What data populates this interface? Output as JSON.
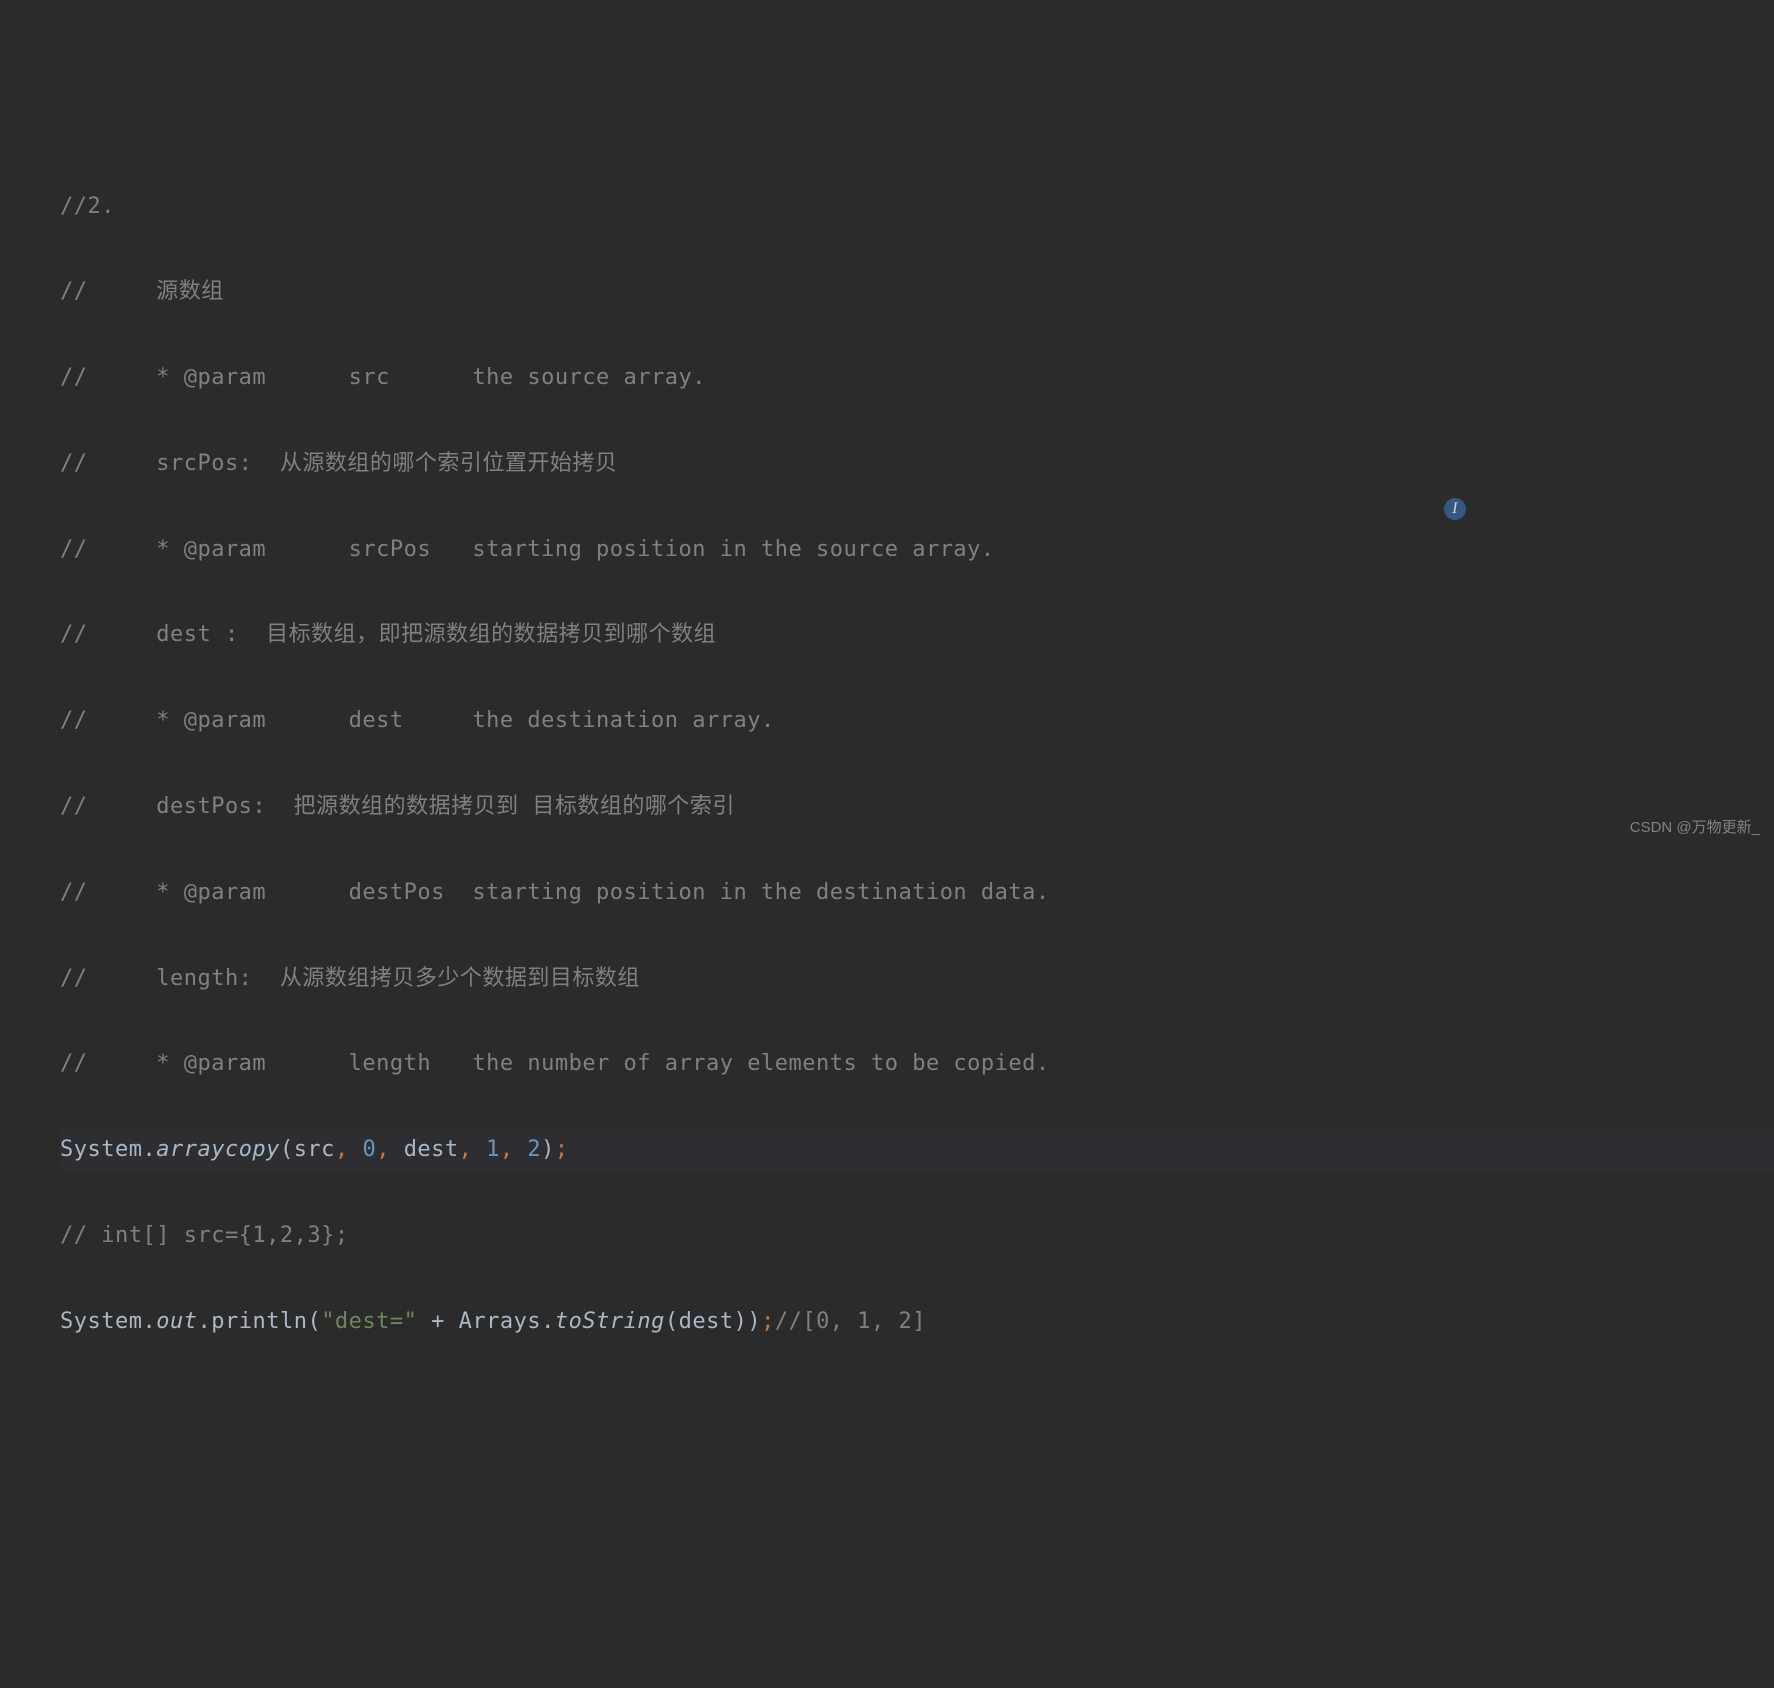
{
  "lines": {
    "l1": "//2.",
    "l2": "//     源数组",
    "l3": "//     * @param      src      the source array.",
    "l4": "//     srcPos:  从源数组的哪个索引位置开始拷贝",
    "l5": "//     * @param      srcPos   starting position in the source array.",
    "l6": "//     dest :  目标数组，即把源数组的数据拷贝到哪个数组",
    "l7": "//     * @param      dest     the destination array.",
    "l8": "//     destPos:  把源数组的数据拷贝到 目标数组的哪个索引",
    "l9": "//     * @param      destPos  starting position in the destination data.",
    "l10": "//     length:  从源数组拷贝多少个数据到目标数组",
    "l11": "//     * @param      length   the number of array elements to be copied.",
    "l13": "// int[] src={1,2,3};"
  },
  "code": {
    "system1": "System.",
    "arraycopy": "arraycopy",
    "open1": "(",
    "src": "src",
    "comma": ", ",
    "n0": "0",
    "dest": "dest",
    "n1": "1",
    "n2": "2",
    "close1": ")",
    "semi": ";",
    "system2": "System.",
    "out": "out",
    "dot": ".",
    "println": "println",
    "str": "\"dest=\"",
    "plus": " + ",
    "arrays": "Arrays.",
    "tostring": "toString",
    "destarg": "dest",
    "close2": "))",
    "tailcomment": "//[0, 1, 2]"
  },
  "watermark": "CSDN @万物更新_",
  "cursor_label": "I"
}
